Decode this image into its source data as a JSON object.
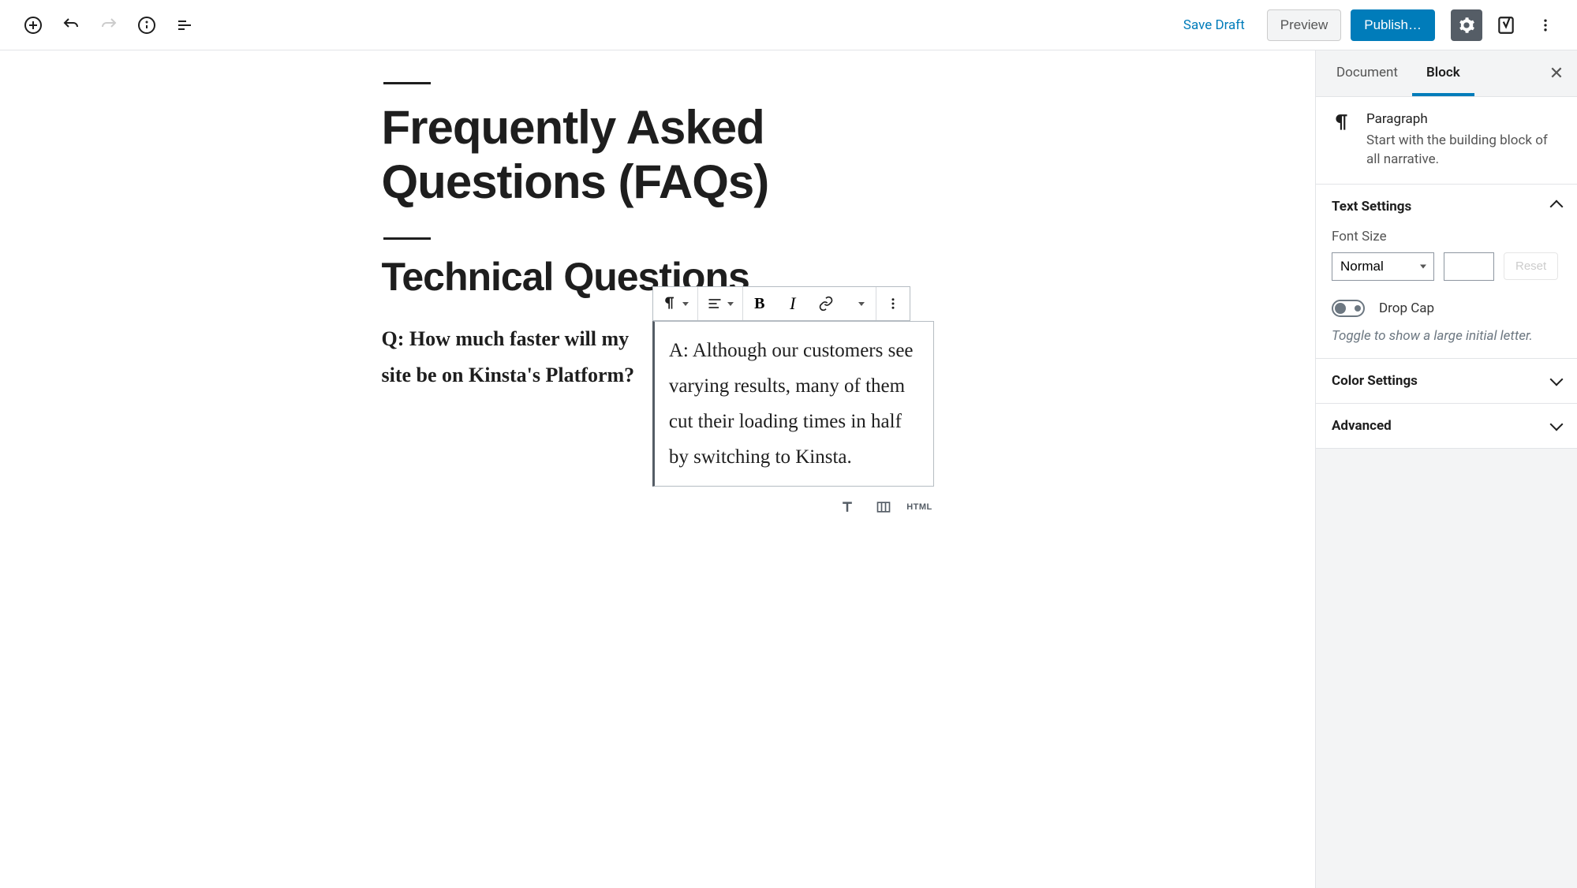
{
  "toolbar": {
    "save_draft": "Save Draft",
    "preview": "Preview",
    "publish": "Publish…"
  },
  "content": {
    "page_title": "Frequently Asked Questions (FAQs)",
    "section_heading": "Technical Questions",
    "question_text": "Q: How much faster will my site be on Kinsta's Platform?",
    "answer_text": "A: Although our customers see varying results, many of them cut their loading times in half by switching to Kinsta."
  },
  "block_inserter": {
    "html_label": "HTML"
  },
  "sidebar": {
    "tabs": {
      "document": "Document",
      "block": "Block"
    },
    "block_info": {
      "title": "Paragraph",
      "description": "Start with the building block of all narrative."
    },
    "text_settings": {
      "heading": "Text Settings",
      "font_size_label": "Font Size",
      "font_size_value": "Normal",
      "reset": "Reset",
      "drop_cap_label": "Drop Cap",
      "drop_cap_hint": "Toggle to show a large initial letter."
    },
    "color_settings": {
      "heading": "Color Settings"
    },
    "advanced": {
      "heading": "Advanced"
    }
  }
}
